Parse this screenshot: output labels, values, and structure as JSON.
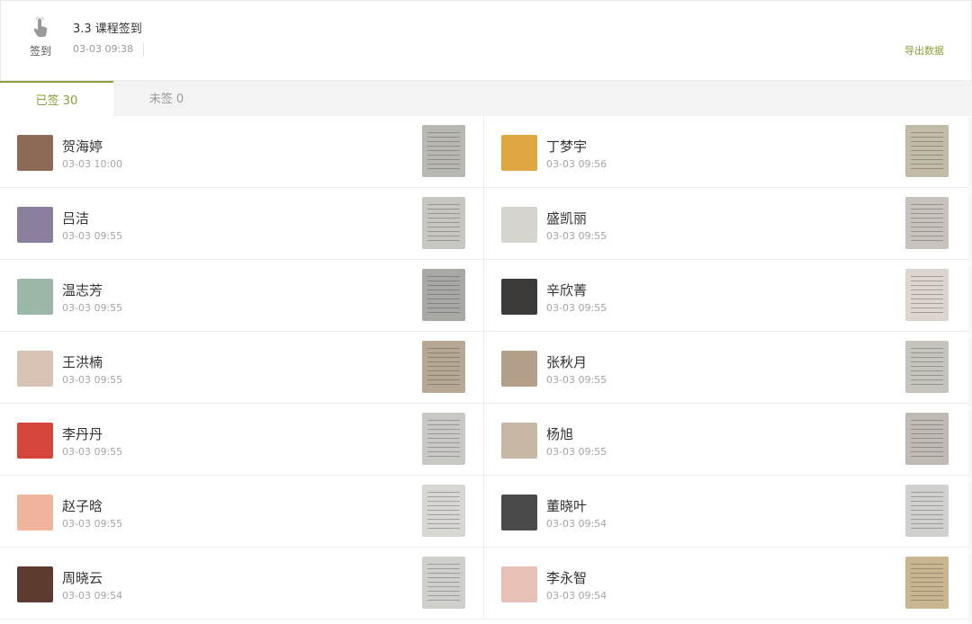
{
  "header": {
    "checkin_label": "签到",
    "title": "3.3 课程签到",
    "time": "03-03 09:38",
    "export_label": "导出数据"
  },
  "colors": {
    "accent": "#8a9f3a"
  },
  "tabs": [
    {
      "label": "已签 30"
    },
    {
      "label": "未签 0"
    }
  ],
  "left_column": [
    {
      "name": "贺海婷",
      "time": "03-03 10:00",
      "avatar": "#8d6a55",
      "photo": "#b9b7b2"
    },
    {
      "name": "吕洁",
      "time": "03-03 09:55",
      "avatar": "#8b7fa0",
      "photo": "#c7c6c1"
    },
    {
      "name": "温志芳",
      "time": "03-03 09:55",
      "avatar": "#9bb8a8",
      "photo": "#a8a8a4"
    },
    {
      "name": "王洪楠",
      "time": "03-03 09:55",
      "avatar": "#d9c3b4",
      "photo": "#b6a892"
    },
    {
      "name": "李丹丹",
      "time": "03-03 09:55",
      "avatar": "#d6453a",
      "photo": "#c9c8c5"
    },
    {
      "name": "赵子晗",
      "time": "03-03 09:55",
      "avatar": "#f0b59d",
      "photo": "#d8d7d3"
    },
    {
      "name": "周晓云",
      "time": "03-03 09:54",
      "avatar": "#5c3a2e",
      "photo": "#cfcfcb"
    }
  ],
  "right_column": [
    {
      "name": "丁梦宇",
      "time": "03-03 09:56",
      "avatar": "#e0a640",
      "photo": "#c2bba5"
    },
    {
      "name": "盛凯丽",
      "time": "03-03 09:55",
      "avatar": "#d7d3cf",
      "photo": "#c8c4bd"
    },
    {
      "name": "辛欣菁",
      "time": "03-03 09:55",
      "avatar": "#3d3b3a",
      "photo": "#ddd6cf"
    },
    {
      "name": "张秋月",
      "time": "03-03 09:55",
      "avatar": "#b4a08a",
      "photo": "#c6c4bd"
    },
    {
      "name": "杨旭",
      "time": "03-03 09:55",
      "avatar": "#c9b7a5",
      "photo": "#bfbab3"
    },
    {
      "name": "董晓叶",
      "time": "03-03 09:54",
      "avatar": "#4a4a4a",
      "photo": "#d0d0ce"
    },
    {
      "name": "李永智",
      "time": "03-03 09:54",
      "avatar": "#e7c1b5",
      "photo": "#c9b58f"
    }
  ]
}
